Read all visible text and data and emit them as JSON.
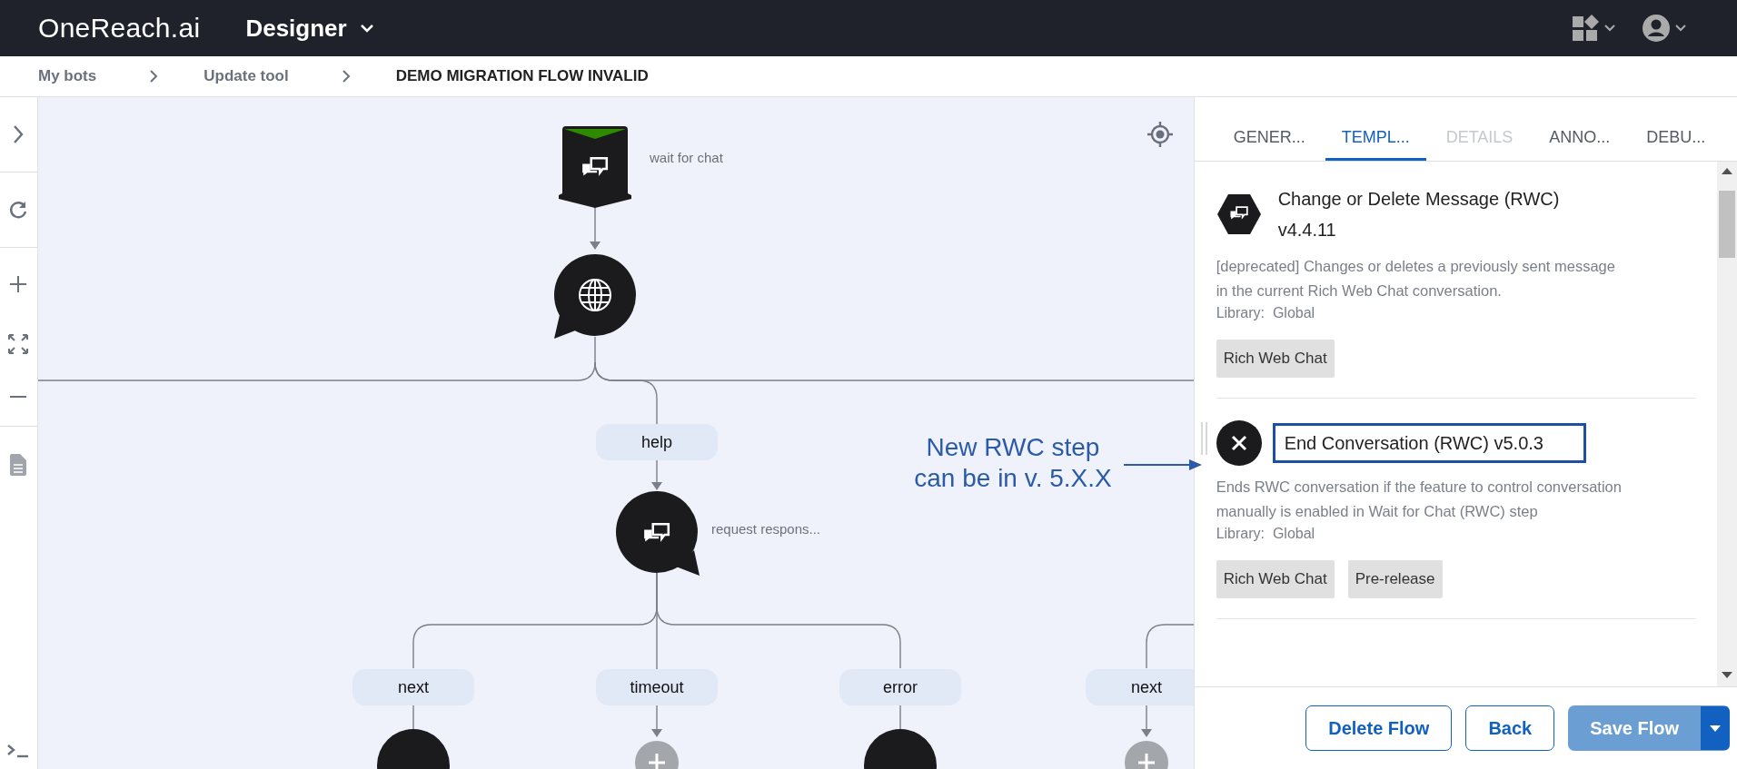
{
  "header": {
    "logo": "OneReach.ai",
    "app_name": "Designer"
  },
  "breadcrumbs": [
    {
      "label": "My bots",
      "current": false
    },
    {
      "label": "Update tool",
      "current": false
    },
    {
      "label": "DEMO MIGRATION FLOW INVALID",
      "current": true
    }
  ],
  "canvas": {
    "trigger_label": "wait for chat",
    "step_label": "request respons...",
    "branch_top": "help",
    "branches": [
      {
        "label": "next",
        "kind": "step"
      },
      {
        "label": "timeout",
        "kind": "add"
      },
      {
        "label": "error",
        "kind": "step"
      },
      {
        "label": "next",
        "kind": "add"
      }
    ]
  },
  "annotation": {
    "text": "New RWC step can be in v. 5.X.X"
  },
  "panel": {
    "tabs": [
      {
        "label": "GENER...",
        "selected": false,
        "disabled": false
      },
      {
        "label": "TEMPL...",
        "selected": true,
        "disabled": false
      },
      {
        "label": "DETAILS",
        "selected": false,
        "disabled": true
      },
      {
        "label": "ANNO...",
        "selected": false,
        "disabled": false
      },
      {
        "label": "DEBU...",
        "selected": false,
        "disabled": false
      }
    ],
    "templates": [
      {
        "kind": "chat",
        "title": "Change or Delete Message (RWC) v4.4.11",
        "highlighted": false,
        "description": "[deprecated] Changes or deletes a previously sent message in the current Rich Web Chat conversation.",
        "library_label": "Library:",
        "library": "Global",
        "tags": [
          "Rich Web Chat"
        ]
      },
      {
        "kind": "close",
        "title": "End Conversation (RWC) v5.0.3",
        "highlighted": true,
        "description": "Ends RWC conversation if the feature to control conversation manually is enabled in Wait for Chat (RWC) step",
        "library_label": "Library:",
        "library": "Global",
        "tags": [
          "Rich Web Chat",
          "Pre-release"
        ]
      }
    ],
    "buttons": [
      {
        "label": "Delete Flow",
        "kind": "outline"
      },
      {
        "label": "Back",
        "kind": "outline"
      },
      {
        "label": "Save Flow",
        "kind": "primary"
      }
    ]
  }
}
